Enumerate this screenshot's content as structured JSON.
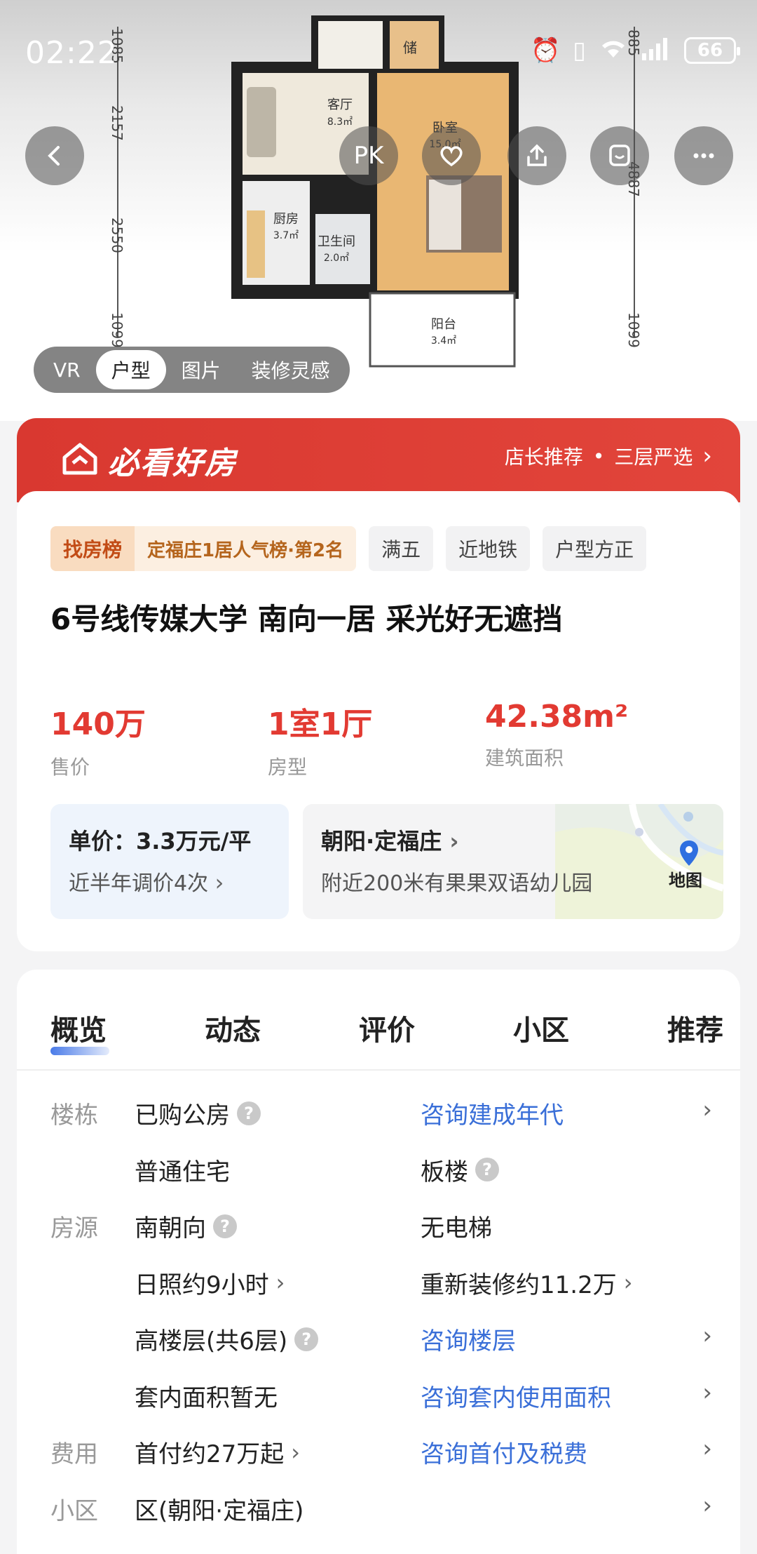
{
  "status_bar": {
    "time": "02:22",
    "battery": "66"
  },
  "floor_plan": {
    "rooms": [
      {
        "name": "储",
        "area": ""
      },
      {
        "name": "客厅",
        "area": "8.3㎡"
      },
      {
        "name": "卧室",
        "area": "15.0㎡"
      },
      {
        "name": "厨房",
        "area": "3.7㎡"
      },
      {
        "name": "卫生间",
        "area": "2.0㎡"
      },
      {
        "name": "阳台",
        "area": "3.4㎡"
      }
    ],
    "dims_left": [
      "1085",
      "2157",
      "2550",
      "1099"
    ],
    "dims_right": [
      "885",
      "4887",
      "1099"
    ]
  },
  "actions": {
    "pk_label": "PK"
  },
  "media_tabs": [
    "VR",
    "户型",
    "图片",
    "装修灵感"
  ],
  "banner": {
    "title": "必看好房",
    "item1": "店长推荐",
    "item2": "三层严选"
  },
  "tags": {
    "rank_label": "找房榜",
    "rank_text": "定福庄1居人气榜·第2名",
    "items": [
      "满五",
      "近地铁",
      "户型方正"
    ]
  },
  "listing": {
    "title": "6号线传媒大学        南向一居 采光好无遮挡",
    "price": "140万",
    "price_label": "售价",
    "layout": "1室1厅",
    "layout_label": "房型",
    "area": "42.38m²",
    "area_label": "建筑面积"
  },
  "unit_price": {
    "main": "单价：3.3万元/平",
    "sub": "近半年调价4次"
  },
  "location": {
    "main": "朝阳·定福庄",
    "sub": "附近200米有果果双语幼儿园",
    "map_label": "地图"
  },
  "overview_tabs": [
    "概览",
    "动态",
    "评价",
    "小区",
    "推荐"
  ],
  "rows": [
    {
      "cat": "楼栋",
      "c1": "已购公房",
      "c1_q": true,
      "c2": "咨询建成年代",
      "c2_link": true,
      "arrow": true
    },
    {
      "cat": "",
      "c1": "普通住宅",
      "c2": "板楼",
      "c2_q": true
    },
    {
      "cat": "房源",
      "c1": "南朝向",
      "c1_q": true,
      "c2": "无电梯"
    },
    {
      "cat": "",
      "c1": "日照约9小时",
      "c1_chev": true,
      "c2": "重新装修约11.2万",
      "c2_chev": true
    },
    {
      "cat": "",
      "c1": "高楼层(共6层)",
      "c1_q": true,
      "c2": "咨询楼层",
      "c2_link": true,
      "arrow": true
    },
    {
      "cat": "",
      "c1": "套内面积暂无",
      "c2": "咨询套内使用面积",
      "c2_link": true,
      "arrow": true
    },
    {
      "cat": "费用",
      "c1": "首付约27万起",
      "c1_chev": true,
      "c2": "咨询首付及税费",
      "c2_link": true,
      "arrow": true
    },
    {
      "cat": "小区",
      "c1": "区(朝阳·定福庄)",
      "arrow": true
    }
  ]
}
